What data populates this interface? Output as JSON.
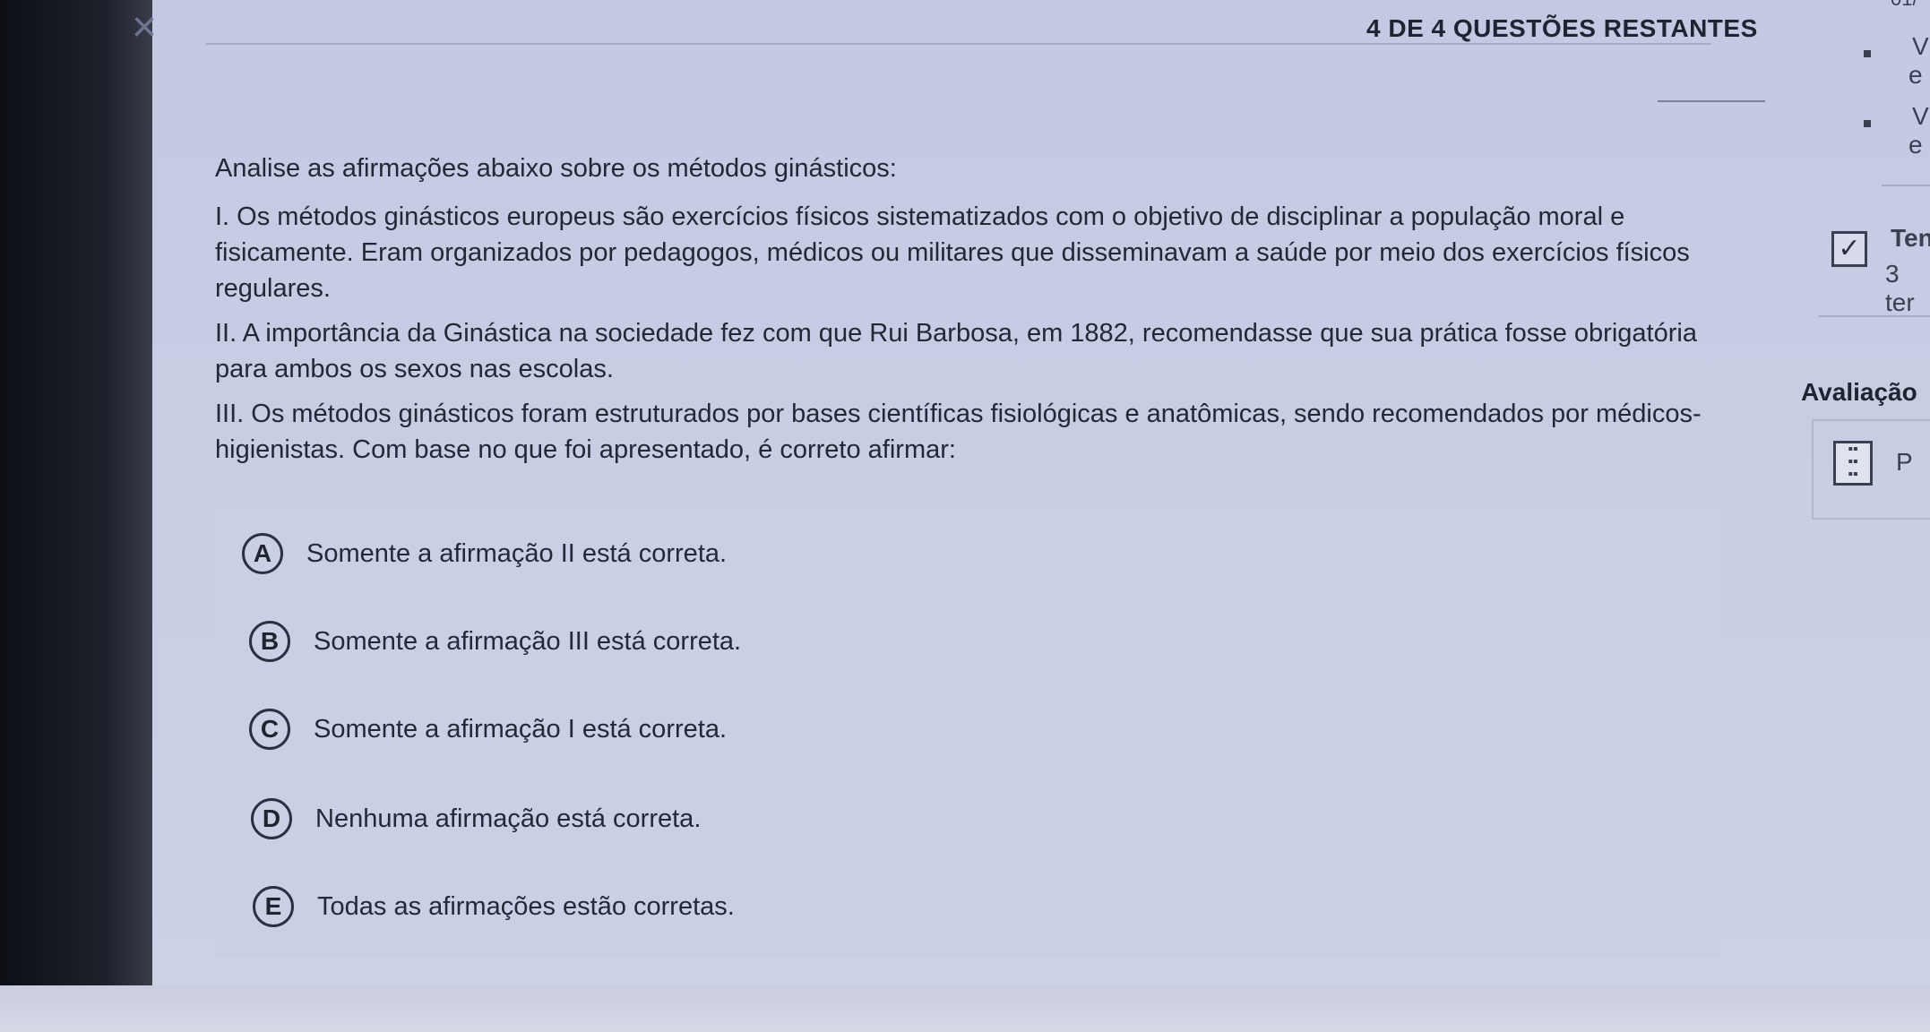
{
  "header": {
    "close_symbol": "×",
    "progress": "4 DE 4 QUESTÕES RESTANTES",
    "top_right_fragment": "01/"
  },
  "question": {
    "intro": "Analise as afirmações abaixo sobre os métodos ginásticos:",
    "statement_1": "I. Os métodos ginásticos europeus são exercícios físicos sistematizados com o objetivo de disciplinar a população moral e fisicamente. Eram organizados por pedagogos, médicos ou militares que disseminavam a saúde por meio dos exercícios físicos regulares.",
    "statement_2": "II. A importância da Ginástica na sociedade fez com que Rui Barbosa, em 1882, recomendasse que sua prática fosse obrigatória para ambos os sexos nas escolas.",
    "statement_3": "III. Os métodos ginásticos foram estruturados por bases científicas fisiológicas e anatômicas, sendo recomendados por médicos-higienistas. Com base no que foi apresentado, é correto afirmar:"
  },
  "options": [
    {
      "letter": "A",
      "text": "Somente a afirmação II está correta."
    },
    {
      "letter": "B",
      "text": "Somente a afirmação III está correta."
    },
    {
      "letter": "C",
      "text": "Somente a afirmação I está correta."
    },
    {
      "letter": "D",
      "text": "Nenhuma afirmação está correta."
    },
    {
      "letter": "E",
      "text": "Todas as afirmações estão corretas."
    }
  ],
  "sidebar": {
    "frag_1": "V",
    "frag_2": "e",
    "frag_3": "V",
    "frag_4": "e",
    "attempts_label": "Tent",
    "attempts_value": "3 ter",
    "evaluation_label": "Avaliação",
    "evaluation_item": "P",
    "check_symbol": "✓"
  },
  "colors": {
    "screen_bg": "#c8cde4",
    "text": "#232836",
    "accent_dark": "#2b3040"
  }
}
